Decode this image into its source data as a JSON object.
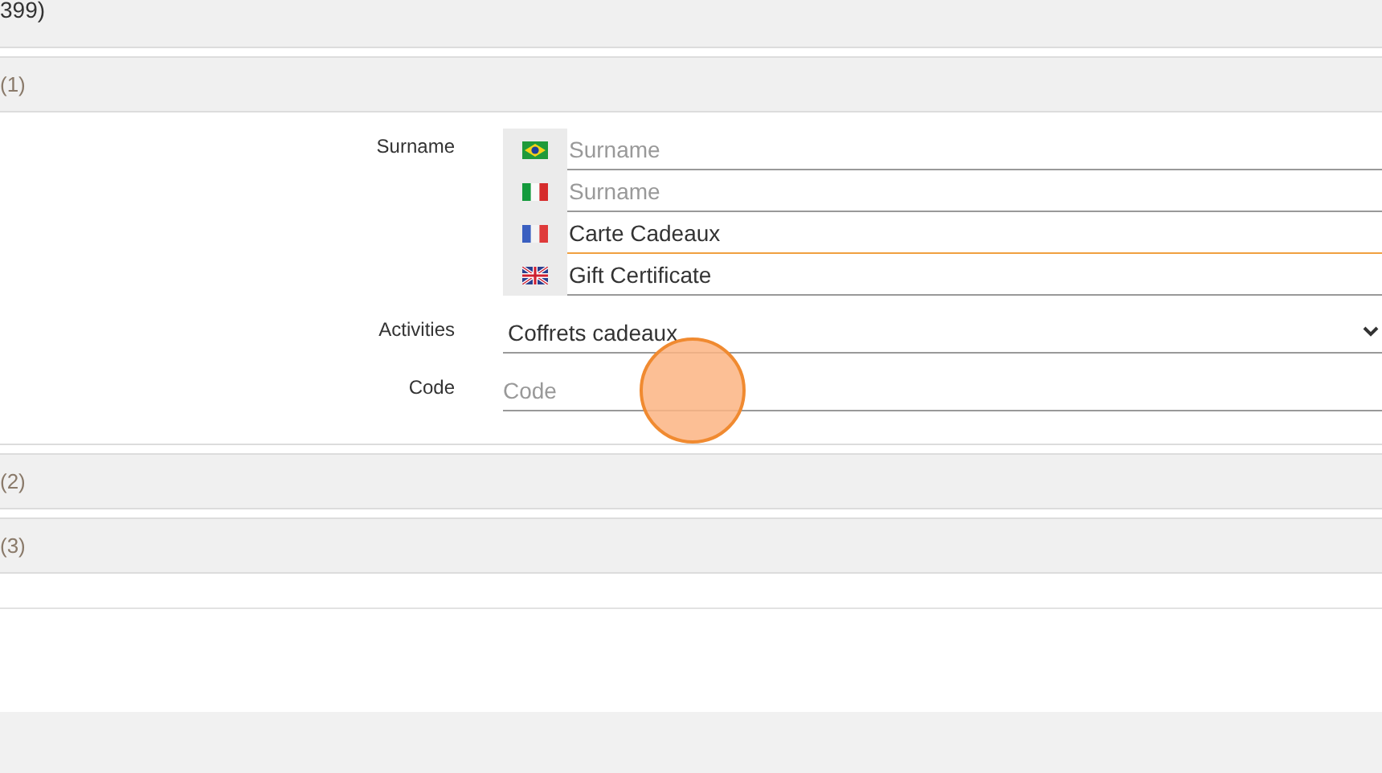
{
  "top_bar": {
    "text": "399)"
  },
  "sections": [
    {
      "title": "(1)"
    },
    {
      "title": "(2)"
    },
    {
      "title": "(3)"
    }
  ],
  "form": {
    "surname": {
      "label": "Surname",
      "translations": [
        {
          "kind": "br",
          "placeholder": "Surname",
          "focused": false
        },
        {
          "kind": "it",
          "placeholder": "Surname",
          "focused": false
        },
        {
          "kind": "fr",
          "value": "Carte Cadeaux",
          "focused": true
        },
        {
          "kind": "gb",
          "value": "Gift Certificate",
          "focused": false
        }
      ]
    },
    "activities": {
      "label": "Activities",
      "value": "Coffrets cadeaux"
    },
    "code": {
      "label": "Code",
      "placeholder": "Code"
    }
  }
}
